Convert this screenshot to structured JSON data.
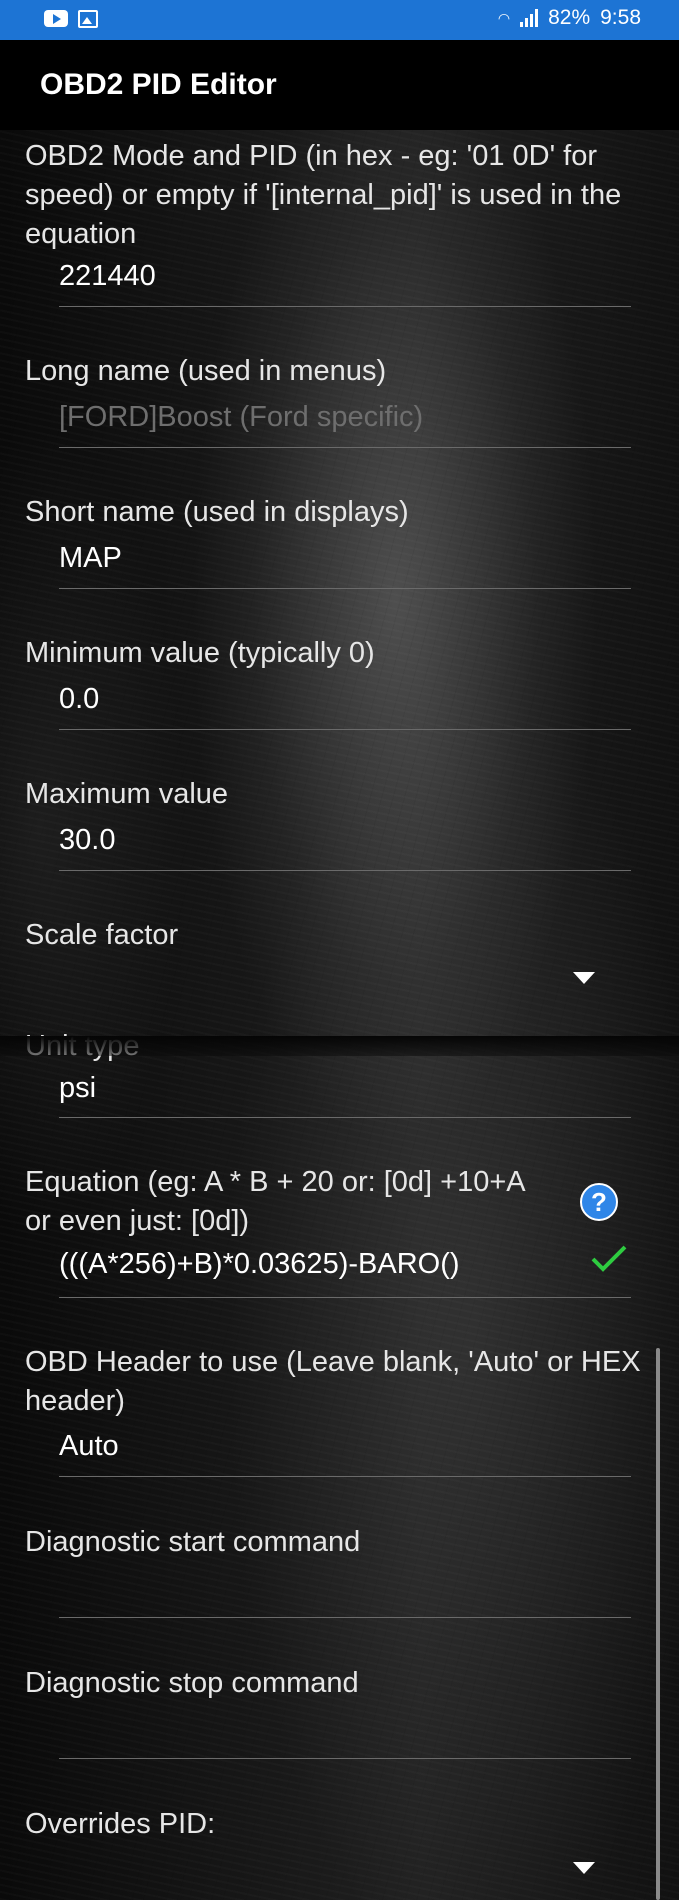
{
  "status_bar": {
    "battery": "82%",
    "time": "9:58",
    "icons": [
      "youtube-icon",
      "gallery-icon",
      "wifi-icon",
      "signal-icon"
    ]
  },
  "app_bar": {
    "title": "OBD2 PID Editor"
  },
  "fields": {
    "mode_pid": {
      "label": "OBD2 Mode and PID (in hex - eg: '01 0D' for speed) or empty if '[internal_pid]' is used in the equation",
      "value": "221440"
    },
    "long_name": {
      "label": "Long name (used in menus)",
      "placeholder": "[FORD]Boost (Ford specific)"
    },
    "short_name": {
      "label": "Short name (used in displays)",
      "value": "MAP"
    },
    "min_value": {
      "label": "Minimum value (typically 0)",
      "value": "0.0"
    },
    "max_value": {
      "label": "Maximum value",
      "value": "30.0"
    },
    "scale_factor": {
      "label": "Scale factor"
    },
    "unit_type": {
      "label": "Unit type",
      "value": "psi"
    },
    "equation": {
      "label": "Equation (eg:  A * B + 20   or: [0d] +10+A  or even just: [0d])",
      "value": "(((A*256)+B)*0.03625)-BARO()"
    },
    "obd_header": {
      "label": "OBD Header to use (Leave blank, 'Auto' or HEX header)",
      "value": "Auto"
    },
    "diag_start": {
      "label": "Diagnostic start command",
      "value": ""
    },
    "diag_stop": {
      "label": "Diagnostic stop command",
      "value": ""
    },
    "overrides_pid": {
      "label": "Overrides PID:"
    }
  },
  "colors": {
    "status_bar": "#1d74d4",
    "app_bar": "#000000",
    "help_icon": "#2f86e8",
    "check_icon": "#2ecc40"
  }
}
